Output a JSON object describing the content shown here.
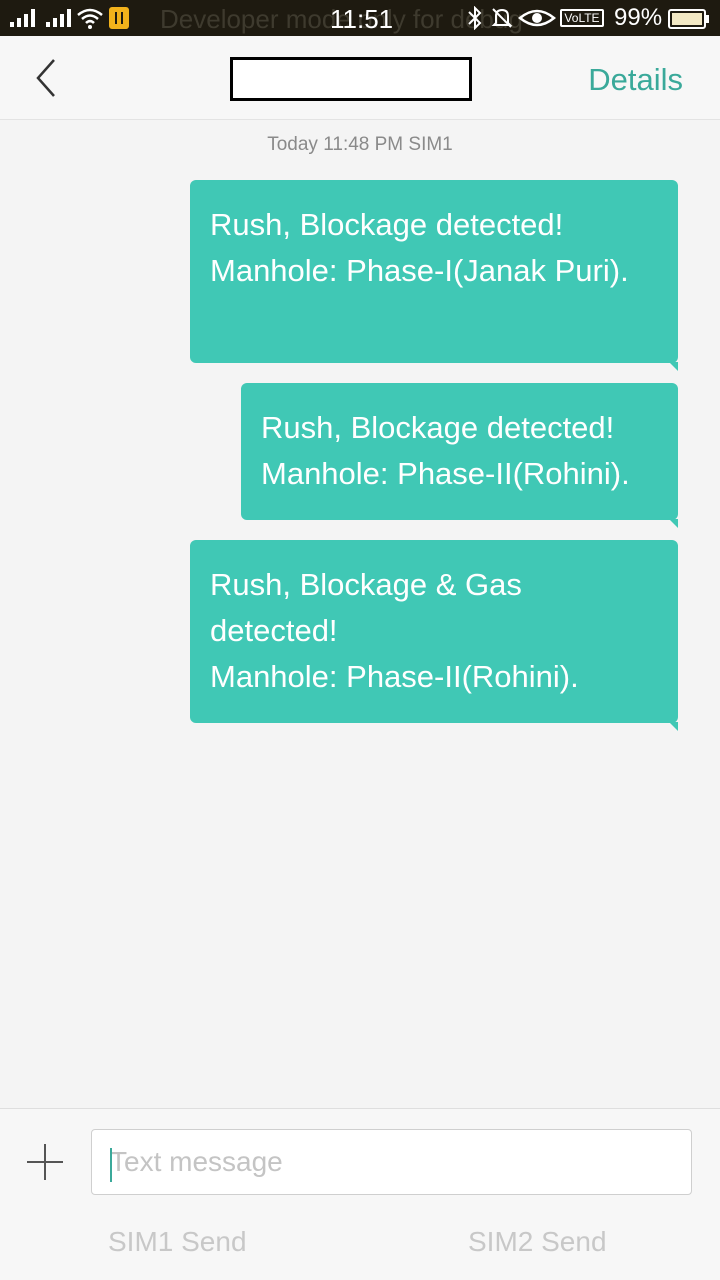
{
  "status_bar": {
    "time": "11:51",
    "battery": "99%",
    "volte": "VoLTE",
    "background_notice": "Developer mode only for debug",
    "icons": [
      "signal-icon",
      "signal-icon",
      "wifi-icon",
      "sim-alert-icon",
      "bluetooth-icon",
      "mute-icon",
      "eye-icon",
      "volte-icon",
      "battery-icon"
    ]
  },
  "header": {
    "contact_name": "",
    "details_label": "Details"
  },
  "conversation": {
    "timestamp": "Today  11:48 PM  SIM1",
    "messages": [
      {
        "text": "Rush, Blockage detected!\nManhole: Phase-I(Janak Puri)."
      },
      {
        "text": "Rush, Blockage detected!\nManhole: Phase-II(Rohini)."
      },
      {
        "text": "Rush, Blockage & Gas detected!\nManhole: Phase-II(Rohini)."
      }
    ]
  },
  "composer": {
    "placeholder": "Text message",
    "sim1_send": "SIM1 Send",
    "sim2_send": "SIM2 Send"
  },
  "colors": {
    "accent": "#3aa99a",
    "bubble": "#40c8b5",
    "status_bar_bg": "#1e1a10"
  }
}
